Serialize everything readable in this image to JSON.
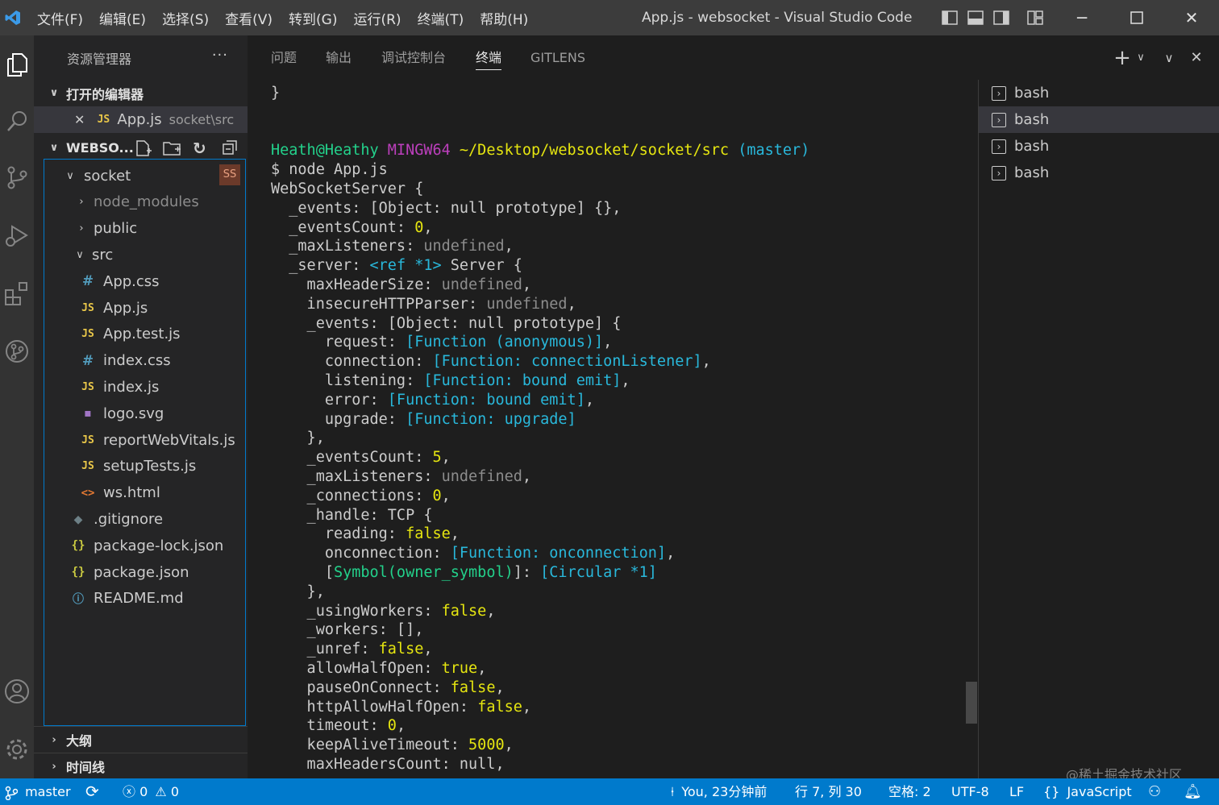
{
  "titlebar": {
    "menu": [
      "文件(F)",
      "编辑(E)",
      "选择(S)",
      "查看(V)",
      "转到(G)",
      "运行(R)",
      "终端(T)",
      "帮助(H)"
    ],
    "window_title": "App.js - websocket - Visual Studio Code"
  },
  "sidebar": {
    "header": "资源管理器",
    "more": "···",
    "open_editors": {
      "label": "打开的编辑器",
      "items": [
        {
          "icon": "JS",
          "name": "App.js",
          "path": "socket\\src"
        }
      ]
    },
    "project": {
      "label": "WEBSO...",
      "tree": [
        {
          "name": "socket",
          "badge": "SS"
        },
        {
          "name": "node_modules"
        },
        {
          "name": "public"
        },
        {
          "name": "src"
        },
        {
          "icon": "#",
          "name": "App.css"
        },
        {
          "icon": "JS",
          "name": "App.js"
        },
        {
          "icon": "JS",
          "name": "App.test.js"
        },
        {
          "icon": "#",
          "name": "index.css"
        },
        {
          "icon": "JS",
          "name": "index.js"
        },
        {
          "icon": "▪",
          "name": "logo.svg"
        },
        {
          "icon": "JS",
          "name": "reportWebVitals.js"
        },
        {
          "icon": "JS",
          "name": "setupTests.js"
        },
        {
          "icon": "<>",
          "name": "ws.html"
        },
        {
          "icon": "◆",
          "name": ".gitignore"
        },
        {
          "icon": "{}",
          "name": "package-lock.json"
        },
        {
          "icon": "{}",
          "name": "package.json"
        },
        {
          "icon": "ⓘ",
          "name": "README.md"
        }
      ]
    },
    "outline_label": "大纲",
    "timeline_label": "时间线"
  },
  "panel": {
    "tabs": [
      "问题",
      "输出",
      "调试控制台",
      "终端",
      "GITLENS"
    ],
    "active_tab": "终端"
  },
  "terminal": {
    "lines": [
      [
        {
          "t": "}"
        }
      ],
      [
        {
          "t": ""
        }
      ],
      [
        {
          "t": "Heath@Heathy ",
          "c": "g"
        },
        {
          "t": "MINGW64 ",
          "c": "m"
        },
        {
          "t": "~/Desktop/websocket/socket/src ",
          "c": "y"
        },
        {
          "t": "(master)",
          "c": "c"
        }
      ],
      [
        {
          "t": "$ node App.js"
        }
      ],
      [
        {
          "t": "WebSocketServer {"
        }
      ],
      [
        {
          "t": "  _events: [Object: null prototype] {},"
        }
      ],
      [
        {
          "t": "  _eventsCount: "
        },
        {
          "t": "0",
          "c": "y"
        },
        {
          "t": ","
        }
      ],
      [
        {
          "t": "  _maxListeners: "
        },
        {
          "t": "undefined",
          "c": "gr"
        },
        {
          "t": ","
        }
      ],
      [
        {
          "t": "  _server: "
        },
        {
          "t": "<ref *1>",
          "c": "c"
        },
        {
          "t": " Server {"
        }
      ],
      [
        {
          "t": "    maxHeaderSize: "
        },
        {
          "t": "undefined",
          "c": "gr"
        },
        {
          "t": ","
        }
      ],
      [
        {
          "t": "    insecureHTTPParser: "
        },
        {
          "t": "undefined",
          "c": "gr"
        },
        {
          "t": ","
        }
      ],
      [
        {
          "t": "    _events: [Object: null prototype] {"
        }
      ],
      [
        {
          "t": "      request: "
        },
        {
          "t": "[Function (anonymous)]",
          "c": "c"
        },
        {
          "t": ","
        }
      ],
      [
        {
          "t": "      connection: "
        },
        {
          "t": "[Function: connectionListener]",
          "c": "c"
        },
        {
          "t": ","
        }
      ],
      [
        {
          "t": "      listening: "
        },
        {
          "t": "[Function: bound emit]",
          "c": "c"
        },
        {
          "t": ","
        }
      ],
      [
        {
          "t": "      error: "
        },
        {
          "t": "[Function: bound emit]",
          "c": "c"
        },
        {
          "t": ","
        }
      ],
      [
        {
          "t": "      upgrade: "
        },
        {
          "t": "[Function: upgrade]",
          "c": "c"
        }
      ],
      [
        {
          "t": "    },"
        }
      ],
      [
        {
          "t": "    _eventsCount: "
        },
        {
          "t": "5",
          "c": "y"
        },
        {
          "t": ","
        }
      ],
      [
        {
          "t": "    _maxListeners: "
        },
        {
          "t": "undefined",
          "c": "gr"
        },
        {
          "t": ","
        }
      ],
      [
        {
          "t": "    _connections: "
        },
        {
          "t": "0",
          "c": "y"
        },
        {
          "t": ","
        }
      ],
      [
        {
          "t": "    _handle: TCP {"
        }
      ],
      [
        {
          "t": "      reading: "
        },
        {
          "t": "false",
          "c": "y"
        },
        {
          "t": ","
        }
      ],
      [
        {
          "t": "      onconnection: "
        },
        {
          "t": "[Function: onconnection]",
          "c": "c"
        },
        {
          "t": ","
        }
      ],
      [
        {
          "t": "      ["
        },
        {
          "t": "Symbol(owner_symbol)",
          "c": "grn"
        },
        {
          "t": "]: "
        },
        {
          "t": "[Circular *1]",
          "c": "c"
        }
      ],
      [
        {
          "t": "    },"
        }
      ],
      [
        {
          "t": "    _usingWorkers: "
        },
        {
          "t": "false",
          "c": "y"
        },
        {
          "t": ","
        }
      ],
      [
        {
          "t": "    _workers: [],"
        }
      ],
      [
        {
          "t": "    _unref: "
        },
        {
          "t": "false",
          "c": "y"
        },
        {
          "t": ","
        }
      ],
      [
        {
          "t": "    allowHalfOpen: "
        },
        {
          "t": "true",
          "c": "y"
        },
        {
          "t": ","
        }
      ],
      [
        {
          "t": "    pauseOnConnect: "
        },
        {
          "t": "false",
          "c": "y"
        },
        {
          "t": ","
        }
      ],
      [
        {
          "t": "    httpAllowHalfOpen: "
        },
        {
          "t": "false",
          "c": "y"
        },
        {
          "t": ","
        }
      ],
      [
        {
          "t": "    timeout: "
        },
        {
          "t": "0",
          "c": "y"
        },
        {
          "t": ","
        }
      ],
      [
        {
          "t": "    keepAliveTimeout: "
        },
        {
          "t": "5000",
          "c": "y"
        },
        {
          "t": ","
        }
      ],
      [
        {
          "t": "    maxHeadersCount: null,"
        }
      ]
    ]
  },
  "terminal_list": [
    "bash",
    "bash",
    "bash",
    "bash"
  ],
  "statusbar": {
    "branch": "master",
    "errors": "0",
    "warnings": "0",
    "blame": "You, 23分钟前",
    "position": "行 7, 列 30",
    "spaces": "空格: 2",
    "encoding": "UTF-8",
    "eol": "LF",
    "language": "JavaScript"
  },
  "watermark": "@稀土掘金技术社区",
  "colors": {
    "accent": "#007acc",
    "titlebar": "#3c3c3c",
    "sidebar": "#252526",
    "editor": "#1e1e1e"
  }
}
